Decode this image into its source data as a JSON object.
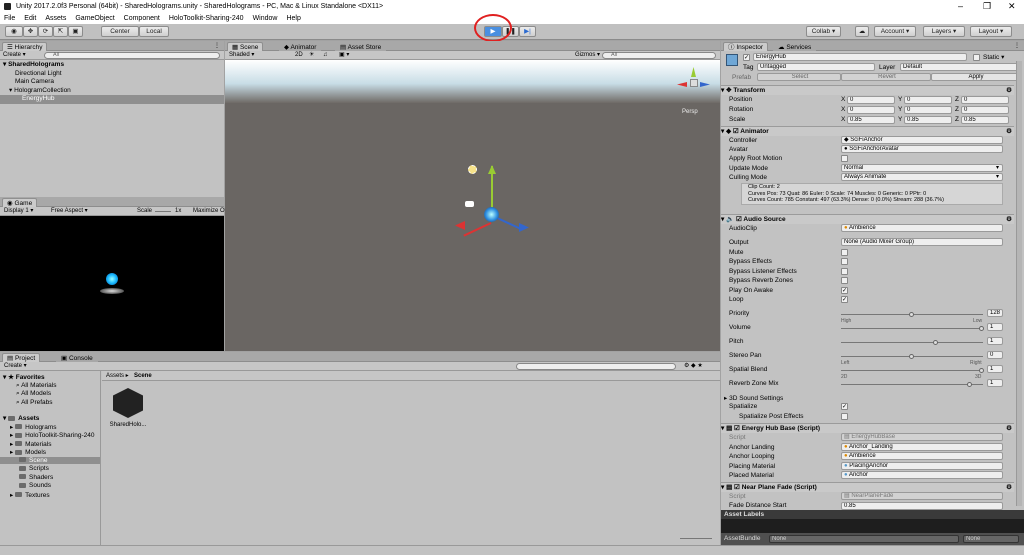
{
  "window": {
    "title": "Unity 2017.2.0f3 Personal (64bit) - SharedHolograms.unity - SharedHolograms - PC, Mac & Linux Standalone <DX11>"
  },
  "menu": [
    "File",
    "Edit",
    "Assets",
    "GameObject",
    "Component",
    "HoloToolkit-Sharing-240",
    "Window",
    "Help"
  ],
  "toolbar": {
    "pivot": "Center",
    "space": "Local",
    "collab": "Collab",
    "account": "Account",
    "layers": "Layers",
    "layout": "Layout"
  },
  "hierarchy": {
    "tab": "Hierarchy",
    "create": "Create",
    "search_placeholder": "All",
    "scene": "SharedHolograms",
    "items": [
      "Directional Light",
      "Main Camera",
      "HologramCollection",
      "EnergyHub"
    ]
  },
  "game": {
    "tab": "Game",
    "display": "Display 1",
    "aspect": "Free Aspect",
    "scale_label": "Scale",
    "scale_value": "1x",
    "maximize": "Maximize O"
  },
  "scene_view": {
    "tabs": [
      "Scene",
      "Animator",
      "Asset Store"
    ],
    "shading": "Shaded",
    "mode_2d": "2D",
    "gizmos": "Gizmos",
    "search_placeholder": "All",
    "persp": "Persp"
  },
  "project": {
    "tabs": [
      "Project",
      "Console"
    ],
    "create": "Create",
    "favorites": "Favorites",
    "favorite_items": [
      "All Materials",
      "All Models",
      "All Prefabs"
    ],
    "assets_root": "Assets",
    "asset_folders": [
      "Holograms",
      "HoloToolkit-Sharing-240",
      "Materials",
      "Models",
      "Scene",
      "Scripts",
      "Shaders",
      "Sounds",
      "Textures"
    ],
    "breadcrumb_root": "Assets",
    "breadcrumb_current": "Scene",
    "asset_name": "SharedHolo..."
  },
  "inspector": {
    "tabs": [
      "Inspector",
      "Services"
    ],
    "object_name": "EnergyHub",
    "static_label": "Static",
    "tag_label": "Tag",
    "tag_value": "Untagged",
    "layer_label": "Layer",
    "layer_value": "Default",
    "prefab_label": "Prefab",
    "prefab_buttons": [
      "Select",
      "Revert",
      "Apply"
    ],
    "transform": {
      "title": "Transform",
      "rows": [
        {
          "label": "Position",
          "x": "0",
          "y": "0",
          "z": "0"
        },
        {
          "label": "Rotation",
          "x": "0",
          "y": "0",
          "z": "0"
        },
        {
          "label": "Scale",
          "x": "0.85",
          "y": "0.85",
          "z": "0.85"
        }
      ]
    },
    "animator": {
      "title": "Animator",
      "controller_label": "Controller",
      "controller_value": "SciFiAnchor",
      "avatar_label": "Avatar",
      "avatar_value": "SciFiAnchorAvatar",
      "apply_root_motion": "Apply Root Motion",
      "update_mode_label": "Update Mode",
      "update_mode_value": "Normal",
      "culling_mode_label": "Culling Mode",
      "culling_mode_value": "Always Animate",
      "info1": "Clip Count: 2",
      "info2": "Curves Pos: 73 Quat: 86 Euler: 0 Scale: 74 Muscles: 0 Generic: 0 PPtr: 0",
      "info3": "Curves Count: 785 Constant: 497 (63.3%) Dense: 0 (0.0%) Stream: 288 (36.7%)"
    },
    "audio": {
      "title": "Audio Source",
      "clip_label": "AudioClip",
      "clip_value": "Ambience",
      "output_label": "Output",
      "output_value": "None (Audio Mixer Group)",
      "mute": "Mute",
      "bypass_effects": "Bypass Effects",
      "bypass_listener": "Bypass Listener Effects",
      "bypass_reverb": "Bypass Reverb Zones",
      "play_on_awake": "Play On Awake",
      "loop": "Loop",
      "priority_label": "Priority",
      "priority_value": "128",
      "priority_fill": 0.5,
      "high": "High",
      "low": "Low",
      "volume_label": "Volume",
      "volume_value": "1",
      "pitch_label": "Pitch",
      "pitch_value": "1",
      "stereo_label": "Stereo Pan",
      "stereo_value": "0",
      "left": "Left",
      "right": "Right",
      "spatial_label": "Spatial Blend",
      "spatial_value": "1",
      "d2": "2D",
      "d3": "3D",
      "reverb_label": "Reverb Zone Mix",
      "reverb_value": "1",
      "sound_settings": "3D Sound Settings",
      "spatialize": "Spatialize",
      "spatialize_post": "Spatialize Post Effects"
    },
    "energy_script": {
      "title": "Energy Hub Base (Script)",
      "script_label": "Script",
      "script_value": "EnergyHubBase",
      "fields": [
        {
          "label": "Anchor Landing",
          "value": "Anchor_Landing"
        },
        {
          "label": "Anchor Looping",
          "value": "Ambience"
        },
        {
          "label": "Placing Material",
          "value": "PlacingAnchor"
        },
        {
          "label": "Placed Material",
          "value": "Anchor"
        }
      ]
    },
    "fade_script": {
      "title": "Near Plane Fade (Script)",
      "script_label": "Script",
      "script_value": "NearPlaneFade",
      "fade_label": "Fade Distance Start",
      "fade_value": "0.85"
    },
    "asset_labels": "Asset Labels",
    "asset_bundle_label": "AssetBundle",
    "asset_bundle_value": "None",
    "asset_bundle_variant": "None"
  }
}
